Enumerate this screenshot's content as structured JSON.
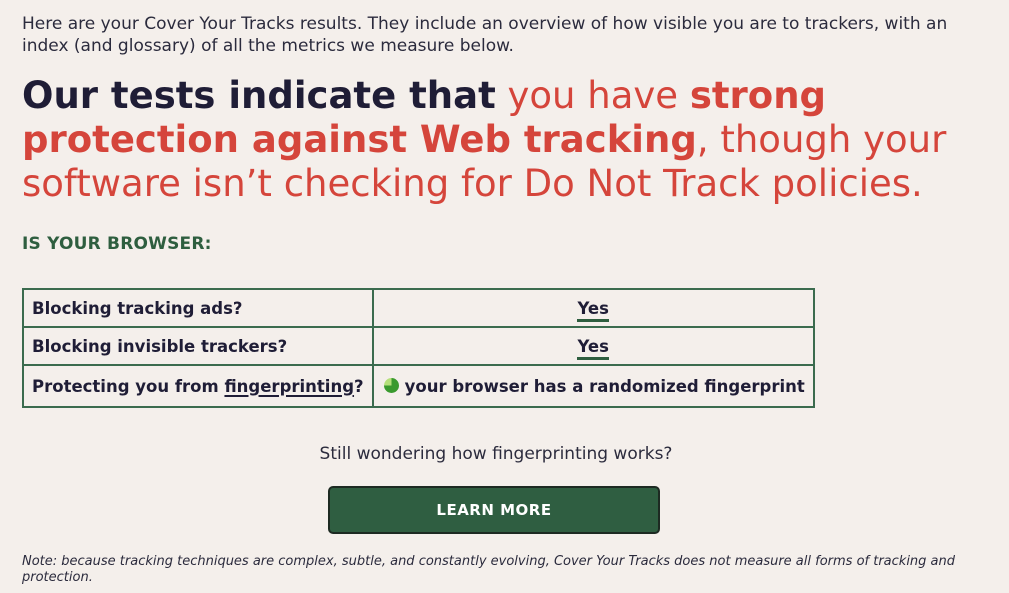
{
  "intro": {
    "text": "Here are your Cover Your Tracks results. They include an overview of how visible you are to trackers, with an index (and glossary) of all the metrics we measure below."
  },
  "headline": {
    "part1": "Our tests indicate that",
    "part2": " you have ",
    "part3": "strong protection against Web tracking",
    "part4": ", though your software isn’t checking for Do Not Track policies."
  },
  "section": {
    "question": "IS YOUR BROWSER:"
  },
  "results": {
    "rows": [
      {
        "question": "Blocking tracking ads?",
        "answer": "Yes"
      },
      {
        "question": "Blocking invisible trackers?",
        "answer": "Yes"
      },
      {
        "question_prefix": "Protecting you from ",
        "question_link": "fingerprinting",
        "question_suffix": "?",
        "answer": "your browser has a randomized fingerprint"
      }
    ]
  },
  "cta": {
    "prompt": "Still wondering how fingerprinting works?",
    "button_label": "LEARN MORE"
  },
  "note": {
    "text": "Note: because tracking techniques are complex, subtle, and constantly evolving, Cover Your Tracks does not measure all forms of tracking and protection."
  },
  "colors": {
    "background": "#f4efeb",
    "accent_red": "#d5453b",
    "accent_green": "#2e5e3f",
    "text_dark": "#1f1d36"
  },
  "icons": {
    "fingerprint_status": "green-pie-status-icon"
  }
}
